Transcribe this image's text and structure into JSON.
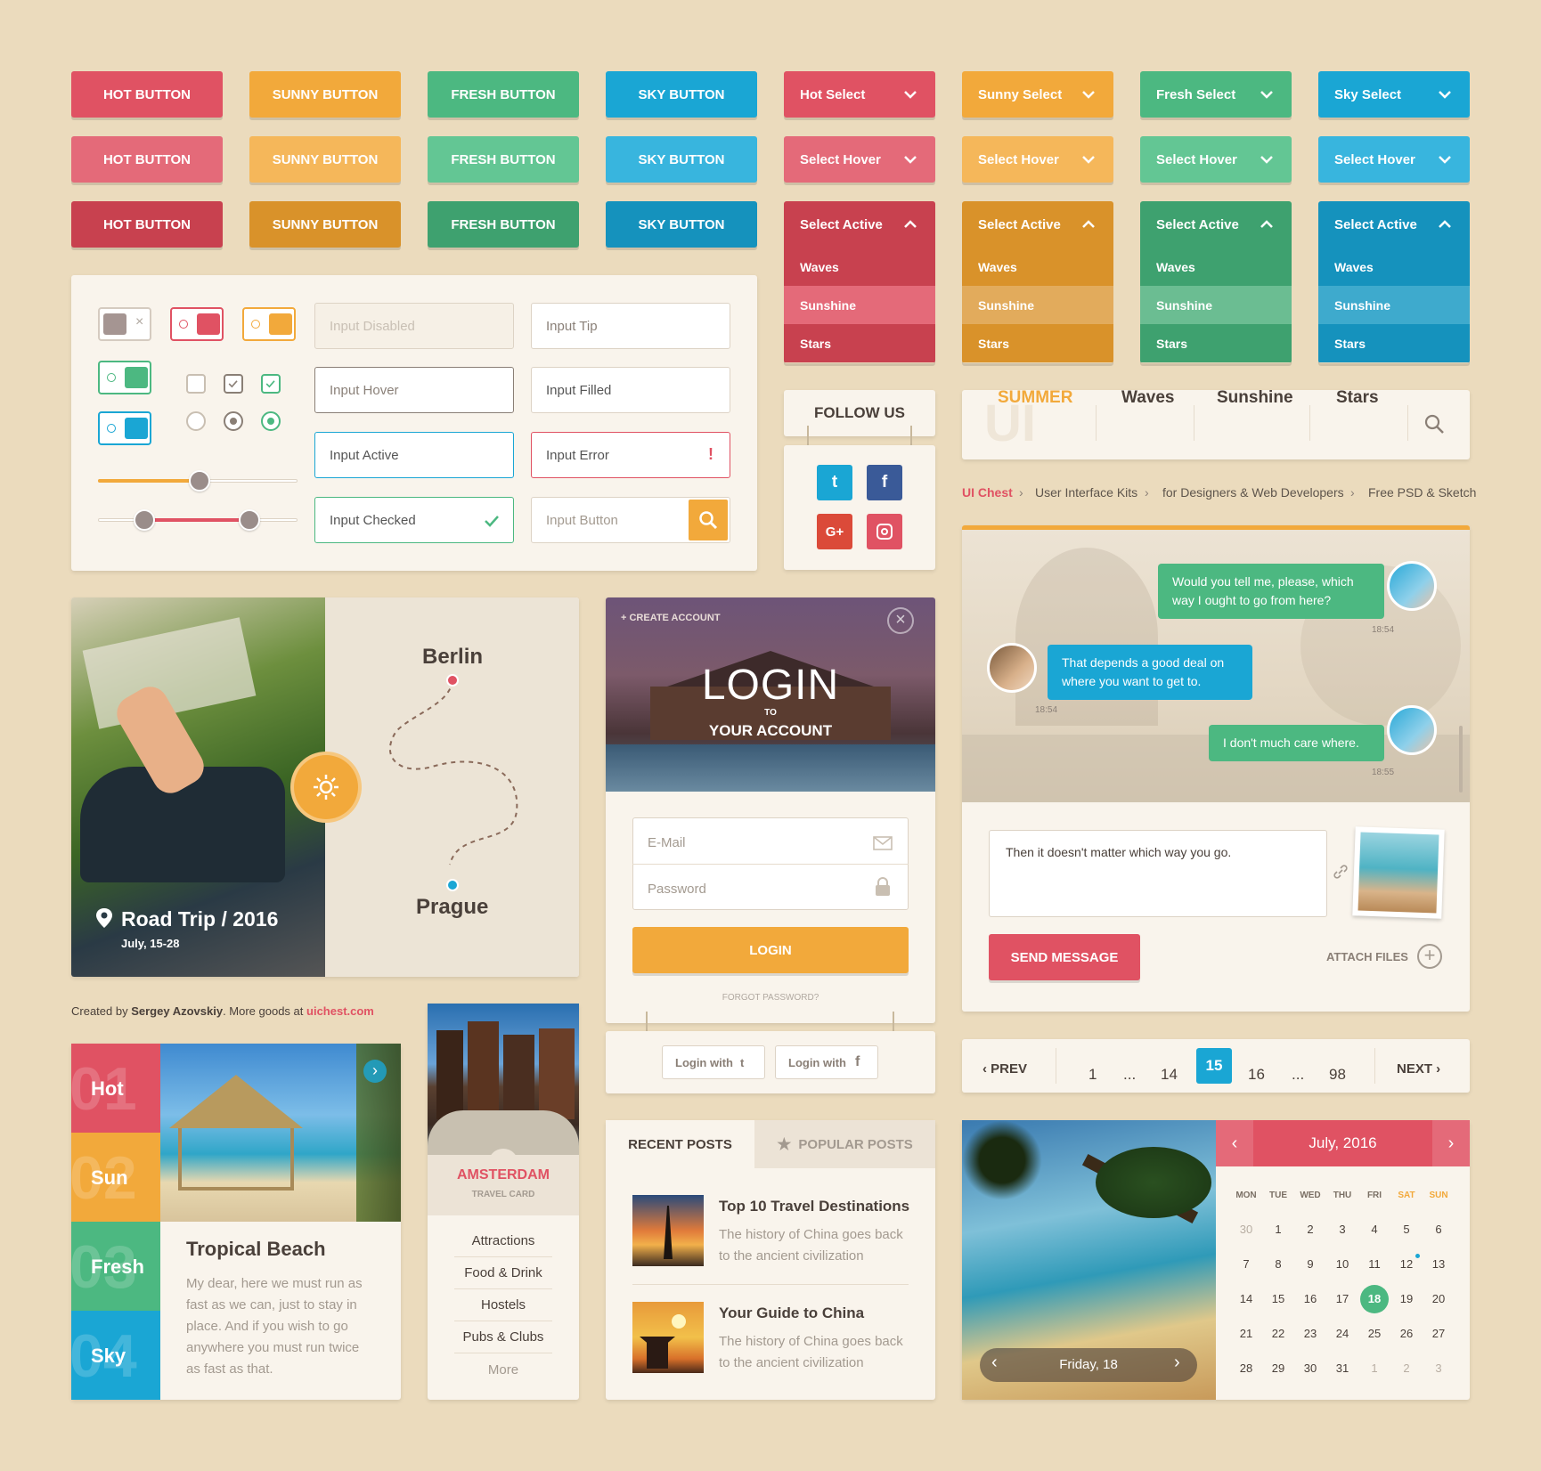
{
  "buttons": {
    "hot": "HOT BUTTON",
    "sunny": "SUNNY BUTTON",
    "fresh": "FRESH BUTTON",
    "sky": "SKY BUTTON"
  },
  "selects": {
    "hot": "Hot Select",
    "sunny": "Sunny Select",
    "fresh": "Fresh Select",
    "sky": "Sky Select",
    "hover": "Select Hover",
    "active": "Select Active",
    "options": [
      "Waves",
      "Sunshine",
      "Stars"
    ]
  },
  "inputs": {
    "disabled": "Input Disabled",
    "tip": "Input Tip",
    "hover": "Input Hover",
    "filled": "Input Filled",
    "active": "Input Active",
    "error": "Input Error",
    "checked": "Input Checked",
    "button": "Input Button"
  },
  "sliders": {
    "single": 0.51,
    "range": [
      0.23,
      0.76
    ]
  },
  "follow": {
    "title": "FOLLOW US"
  },
  "nav": {
    "items": [
      "SUMMER",
      "Waves",
      "Sunshine",
      "Stars"
    ],
    "logo_bg": "UI"
  },
  "breadcrumb": [
    "UI Chest",
    "User Interface Kits",
    "for Designers & Web Developers",
    "Free PSD & Sketch"
  ],
  "chat": {
    "msg1": "Would you tell me, please, which way I ought to go from here?",
    "time1": "18:54",
    "msg2": "That depends a good deal on where you want to get to.",
    "time2": "18:54",
    "msg3": "I don't much care where.",
    "time3": "18:55",
    "draft": "Then it doesn't matter which way you go.",
    "send": "SEND MESSAGE",
    "attach": "ATTACH FILES"
  },
  "trip": {
    "from": "Berlin",
    "to": "Prague",
    "title": "Road Trip / 2016",
    "dates": "July, 15-28"
  },
  "login": {
    "create": "CREATE ACCOUNT",
    "title": "LOGIN",
    "to": "TO",
    "subtitle": "YOUR ACCOUNT",
    "email": "E-Mail",
    "password": "Password",
    "button": "LOGIN",
    "forgot": "FORGOT PASSWORD?",
    "with1": "Login with",
    "with2": "Login with"
  },
  "credit": {
    "prefix": "Created by ",
    "author": "Sergey Azovskiy",
    "mid": ". More goods at ",
    "site": "uichest.com"
  },
  "pagination": {
    "prev": "PREV",
    "next": "NEXT",
    "pages": [
      "1",
      "...",
      "14",
      "15",
      "16",
      "...",
      "98"
    ],
    "current": "15"
  },
  "tabs": {
    "side": [
      {
        "num": "01",
        "label": "Hot"
      },
      {
        "num": "02",
        "label": "Sun"
      },
      {
        "num": "03",
        "label": "Fresh"
      },
      {
        "num": "04",
        "label": "Sky"
      }
    ],
    "title": "Tropical Beach",
    "body": "My dear, here we must run as fast as we can, just to stay in place. And if you wish to go anywhere you must run twice as fast as that."
  },
  "travel": {
    "city": "AMSTERDAM",
    "sub": "TRAVEL CARD",
    "items": [
      "Attractions",
      "Food & Drink",
      "Hostels",
      "Pubs & Clubs",
      "More"
    ]
  },
  "posts": {
    "tab1": "RECENT POSTS",
    "tab2": "POPULAR POSTS",
    "items": [
      {
        "title": "Top 10 Travel Destinations",
        "body": "The history of China goes back to the ancient civilization"
      },
      {
        "title": "Your Guide to China",
        "body": "The history of China goes back to the ancient civilization"
      }
    ]
  },
  "calendar": {
    "month": "July, 2016",
    "day_label": "Friday, 18",
    "dow": [
      "MON",
      "TUE",
      "WED",
      "THU",
      "FRI",
      "SAT",
      "SUN"
    ],
    "selected": "18",
    "rows": [
      [
        "30",
        "1",
        "2",
        "3",
        "4",
        "5",
        "6"
      ],
      [
        "7",
        "8",
        "9",
        "10",
        "11",
        "12",
        "13"
      ],
      [
        "14",
        "15",
        "16",
        "17",
        "18",
        "19",
        "20"
      ],
      [
        "21",
        "22",
        "23",
        "24",
        "25",
        "26",
        "27"
      ],
      [
        "28",
        "29",
        "30",
        "31",
        "1",
        "2",
        "3"
      ]
    ]
  },
  "colors": {
    "hot": "#e05263",
    "sunny": "#f2a93b",
    "fresh": "#4cb881",
    "sky": "#1aa6d4",
    "background": "#ebdbbd"
  }
}
